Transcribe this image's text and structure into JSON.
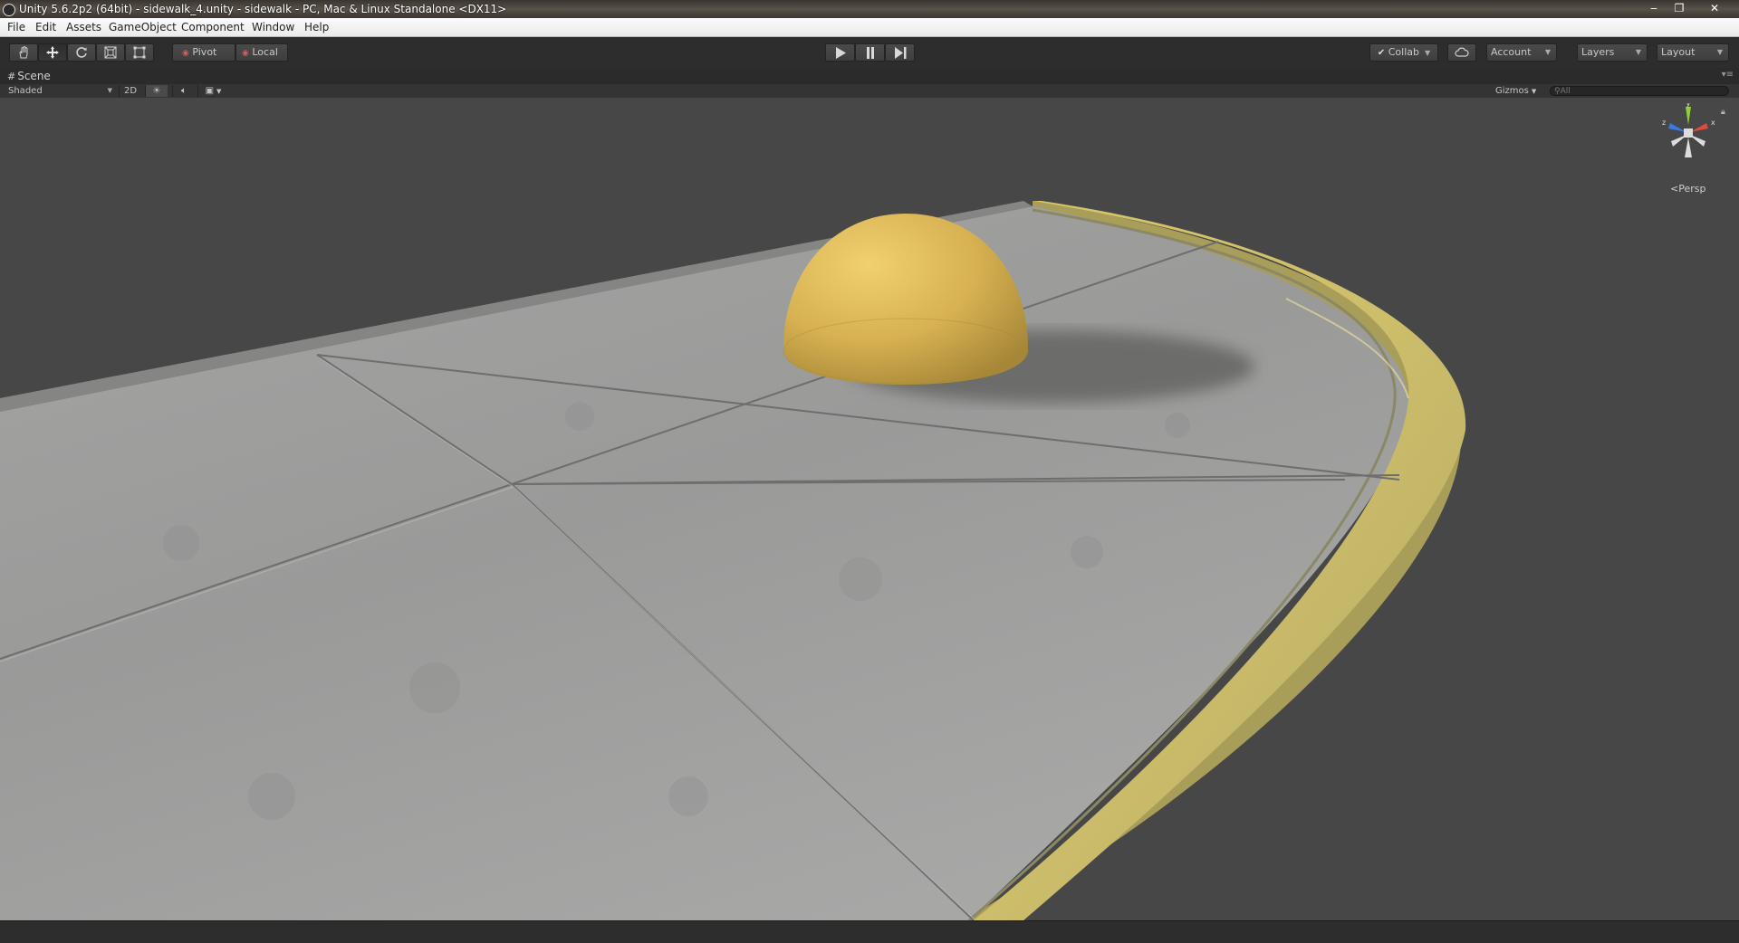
{
  "window": {
    "title": "Unity 5.6.2p2 (64bit) - sidewalk_4.unity - sidewalk - PC, Mac & Linux Standalone <DX11>",
    "minimize_glyph": "‒",
    "maximize_glyph": "❐",
    "close_glyph": "✕"
  },
  "menu": {
    "items": [
      "File",
      "Edit",
      "Assets",
      "GameObject",
      "Component",
      "Window",
      "Help"
    ]
  },
  "toolbar": {
    "transform_tools": [
      "hand-icon",
      "move-icon",
      "rotate-icon",
      "scale-icon",
      "rect-icon"
    ],
    "pivot_label": "Pivot",
    "local_label": "Local",
    "collab_label": "Collab",
    "account_label": "Account",
    "layers_label": "Layers",
    "layout_label": "Layout"
  },
  "scene": {
    "tab_label": "Scene",
    "shading_mode": "Shaded",
    "mode_2d": "2D",
    "gizmos_label": "Gizmos",
    "search_placeholder": "All",
    "projection_label": "Persp",
    "axis_labels": {
      "x": "x",
      "y": "y",
      "z": "z"
    }
  },
  "colors": {
    "sidewalk_concrete": "#9a9a99",
    "curb_yellow": "#d8c769",
    "dome_yellow": "#d9b455",
    "background": "#474747"
  }
}
